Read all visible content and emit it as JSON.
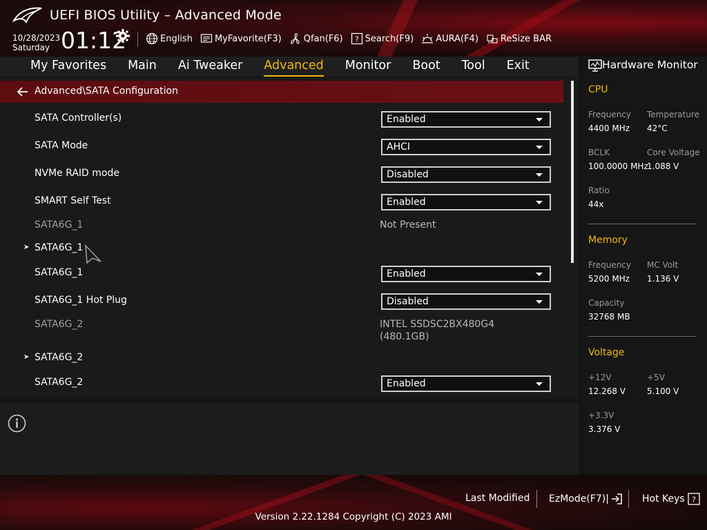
{
  "header": {
    "title": "UEFI BIOS Utility – Advanced Mode",
    "date": "10/28/2023",
    "day": "Saturday",
    "time": "01:12",
    "tools": [
      {
        "label": "English",
        "icon": "globe-icon"
      },
      {
        "label": "MyFavorite(F3)",
        "icon": "favorite-icon"
      },
      {
        "label": "Qfan(F6)",
        "icon": "fan-icon"
      },
      {
        "label": "Search(F9)",
        "icon": "search-icon"
      },
      {
        "label": "AURA(F4)",
        "icon": "aura-icon"
      },
      {
        "label": "ReSize BAR",
        "icon": "resize-bar-icon"
      }
    ]
  },
  "tabs": [
    {
      "label": "My Favorites"
    },
    {
      "label": "Main"
    },
    {
      "label": "Ai Tweaker"
    },
    {
      "label": "Advanced",
      "active": true
    },
    {
      "label": "Monitor"
    },
    {
      "label": "Boot"
    },
    {
      "label": "Tool"
    },
    {
      "label": "Exit"
    }
  ],
  "breadcrumb": "Advanced\\SATA Configuration",
  "settings": [
    {
      "label": "SATA Controller(s)",
      "value": "Enabled"
    },
    {
      "label": "SATA Mode",
      "value": "AHCI"
    },
    {
      "label": "NVMe RAID mode",
      "value": "Disabled"
    },
    {
      "label": "SMART Self Test",
      "value": "Enabled"
    },
    {
      "label": "SATA6G_1",
      "info": "Not Present"
    },
    {
      "label": "SATA6G_1",
      "submenu": true
    },
    {
      "label": "SATA6G_1",
      "value": "Enabled"
    },
    {
      "label": "SATA6G_1 Hot Plug",
      "value": "Disabled"
    },
    {
      "label": "SATA6G_2",
      "info": "INTEL SSDSC2BX480G4",
      "info2": "(480.1GB)"
    },
    {
      "label": "SATA6G_2",
      "submenu": true
    },
    {
      "label": "SATA6G_2",
      "value": "Enabled"
    }
  ],
  "hardware_monitor": {
    "title": "Hardware Monitor",
    "cpu": {
      "section": "CPU",
      "frequency_label": "Frequency",
      "frequency": "4400 MHz",
      "temperature_label": "Temperature",
      "temperature": "42°C",
      "bclk_label": "BCLK",
      "bclk": "100.0000 MHz",
      "core_voltage_label": "Core Voltage",
      "core_voltage": "1.088 V",
      "ratio_label": "Ratio",
      "ratio": "44x"
    },
    "memory": {
      "section": "Memory",
      "frequency_label": "Frequency",
      "frequency": "5200 MHz",
      "mc_volt_label": "MC Volt",
      "mc_volt": "1.136 V",
      "capacity_label": "Capacity",
      "capacity": "32768 MB"
    },
    "voltage": {
      "section": "Voltage",
      "v12_label": "+12V",
      "v12": "12.268 V",
      "v5_label": "+5V",
      "v5": "5.100 V",
      "v33_label": "+3.3V",
      "v33": "3.376 V"
    }
  },
  "footer": {
    "last_modified": "Last Modified",
    "ezmode": "EzMode(F7)|",
    "hot_keys": "Hot Keys",
    "version": "Version 2.22.1284 Copyright (C) 2023 AMI"
  },
  "colors": {
    "accent": "#f0b90b",
    "breadcrumb_bg": "#5b0d10",
    "panel_bg": "#1a1a1a"
  }
}
